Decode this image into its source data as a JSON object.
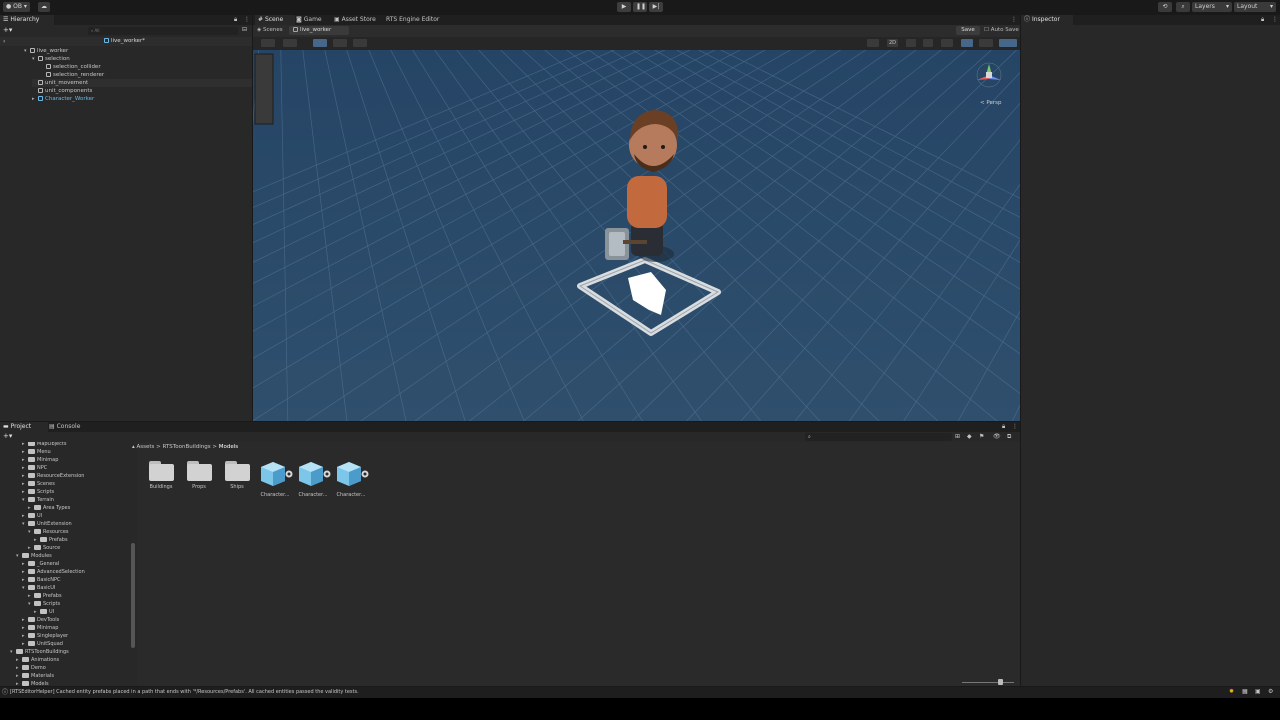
{
  "toolbar": {
    "account_label": "OB",
    "history_icon": "history-icon",
    "search_icon": "search-icon",
    "layers_label": "Layers",
    "layout_label": "Layout"
  },
  "hierarchy": {
    "tab_label": "Hierarchy",
    "search_placeholder": "All",
    "root_label": "live_worker*",
    "items": [
      {
        "label": "live_worker",
        "depth": 0
      },
      {
        "label": "selection",
        "depth": 1
      },
      {
        "label": "selection_collider",
        "depth": 2
      },
      {
        "label": "selection_renderer",
        "depth": 2
      },
      {
        "label": "unit_movement",
        "depth": 1
      },
      {
        "label": "unit_components",
        "depth": 1
      },
      {
        "label": "Character_Worker",
        "depth": 1
      }
    ]
  },
  "scene_tabs": {
    "scene": "Scene",
    "game": "Game",
    "asset_store": "Asset Store",
    "rts_editor": "RTS Engine Editor"
  },
  "breadcrumb": {
    "scenes": "Scenes",
    "prefab": "live_worker",
    "save": "Save",
    "auto_save": "Auto Save"
  },
  "scene_view": {
    "toggle_2d": "2D",
    "persp_label": "< Persp",
    "colors": {
      "sky": "#2b4a68",
      "grid": "#5a7c9c"
    }
  },
  "inspector": {
    "tab_label": "Inspector"
  },
  "project": {
    "tab_project": "Project",
    "tab_console": "Console",
    "tree": [
      {
        "label": "MapObjects",
        "depth": 2
      },
      {
        "label": "Menu",
        "depth": 2
      },
      {
        "label": "Minimap",
        "depth": 2
      },
      {
        "label": "NPC",
        "depth": 2
      },
      {
        "label": "ResourceExtension",
        "depth": 2
      },
      {
        "label": "Scenes",
        "depth": 2
      },
      {
        "label": "Scripts",
        "depth": 2
      },
      {
        "label": "Terrain",
        "depth": 2
      },
      {
        "label": "Area Types",
        "depth": 3
      },
      {
        "label": "UI",
        "depth": 2
      },
      {
        "label": "UnitExtension",
        "depth": 2
      },
      {
        "label": "Resources",
        "depth": 3
      },
      {
        "label": "Prefabs",
        "depth": 4
      },
      {
        "label": "Source",
        "depth": 3
      },
      {
        "label": "Modules",
        "depth": 1
      },
      {
        "label": "_General",
        "depth": 2
      },
      {
        "label": "AdvancedSelection",
        "depth": 2
      },
      {
        "label": "BasicNPC",
        "depth": 2
      },
      {
        "label": "BasicUI",
        "depth": 2
      },
      {
        "label": "Prefabs",
        "depth": 3
      },
      {
        "label": "Scripts",
        "depth": 3
      },
      {
        "label": "UI",
        "depth": 4
      },
      {
        "label": "DevTools",
        "depth": 2
      },
      {
        "label": "Minimap",
        "depth": 2
      },
      {
        "label": "Singleplayer",
        "depth": 2
      },
      {
        "label": "UnitSquad",
        "depth": 2
      },
      {
        "label": "RTSToonBuildings",
        "depth": 0
      },
      {
        "label": "Animations",
        "depth": 1
      },
      {
        "label": "Demo",
        "depth": 1
      },
      {
        "label": "Materials",
        "depth": 1
      },
      {
        "label": "Models",
        "depth": 1
      }
    ],
    "breadcrumb": [
      "Assets",
      "RTSToonBuildings",
      "Models"
    ],
    "assets": [
      {
        "label": "Buildings",
        "kind": "folder"
      },
      {
        "label": "Props",
        "kind": "folder"
      },
      {
        "label": "Ships",
        "kind": "folder"
      },
      {
        "label": "Character...",
        "kind": "prefab"
      },
      {
        "label": "Character...",
        "kind": "prefab"
      },
      {
        "label": "Character...",
        "kind": "prefab"
      }
    ]
  },
  "status": {
    "message": "[RTSEditorHelper] Cached entity prefabs placed in a path that ends with '*/Resources/Prefabs'. All cached entities passed the validity tests."
  }
}
